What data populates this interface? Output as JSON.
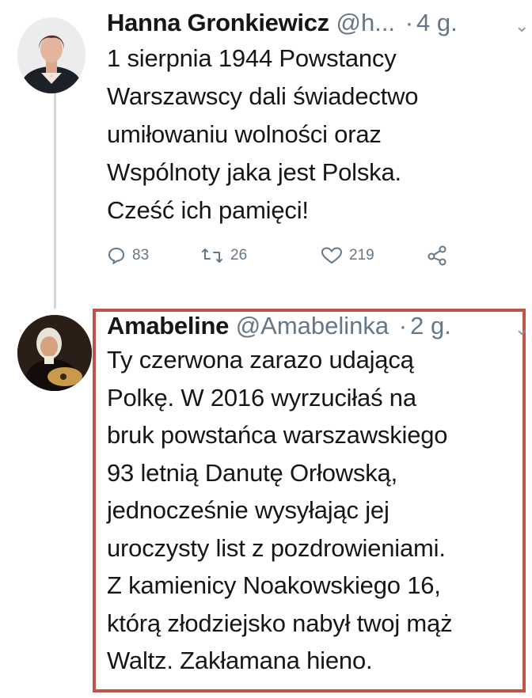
{
  "tweets": [
    {
      "author": "Hanna Gronkiewicz",
      "handle": "@h...",
      "separator": "·",
      "time": "4 g.",
      "lines": [
        "1 sierpnia 1944 Powstancy",
        "Warszawscy dali świadectwo",
        "umiłowaniu wolności oraz",
        "Wspólnoty jaka jest Polska.",
        "Cześć ich pamięci!"
      ],
      "reply_count": "83",
      "retweet_count": "26",
      "like_count": "219",
      "icons": [
        "reply-icon",
        "retweet-icon",
        "like-icon",
        "share-icon"
      ]
    },
    {
      "author": "Amabeline",
      "handle": "@Amabelinka",
      "separator": "·",
      "time": "2 g.",
      "lines": [
        "Ty czerwona zarazo udającą",
        "Polkę. W 2016  wyrzuciłaś na",
        "bruk powstańca warszawskiego",
        "93 letnią Danutę Orłowską,",
        "jednocześnie wysyłając jej",
        "uroczysty list z pozdrowieniami.",
        "Z kamienicy Noakowskiego 16,",
        "którą złodziejsko nabył twoj mąż",
        "Waltz. Zakłamana hieno."
      ]
    }
  ],
  "colors": {
    "text": "#14171a",
    "secondary": "#657786",
    "thread_line": "#cfd6dc",
    "highlight_border": "#c0534b"
  }
}
